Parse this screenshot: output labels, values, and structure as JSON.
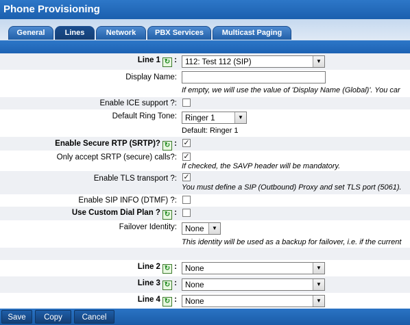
{
  "app": {
    "title": "Phone Provisioning"
  },
  "tabs": [
    {
      "label": "General"
    },
    {
      "label": "Lines"
    },
    {
      "label": "Network"
    },
    {
      "label": "PBX Services"
    },
    {
      "label": "Multicast Paging"
    }
  ],
  "form": {
    "line1": {
      "label": "Line 1",
      "colon": ":",
      "value": "112: Test 112 (SIP)"
    },
    "display_name": {
      "label": "Display Name:",
      "value": "",
      "hint": "If empty, we will use the value of 'Display Name (Global)'. You car"
    },
    "ice": {
      "label": "Enable ICE support ?:",
      "checked": false
    },
    "ring_tone": {
      "label": "Default Ring Tone:",
      "value": "Ringer 1",
      "default_text": "Default: Ringer 1"
    },
    "srtp": {
      "label": "Enable Secure RTP (SRTP)?",
      "colon": ":",
      "checked": true,
      "check_glyph": "✓"
    },
    "srtp_only": {
      "label": "Only accept SRTP (secure) calls?:",
      "checked": true,
      "check_glyph": "✓",
      "hint": "If checked, the SAVP header will be mandatory."
    },
    "tls": {
      "label": "Enable TLS transport ?:",
      "checked": true,
      "check_glyph": "✓",
      "hint": "You must define a SIP (Outbound) Proxy and set TLS port (5061)."
    },
    "sip_info": {
      "label": "Enable SIP INFO (DTMF) ?:",
      "checked": false
    },
    "dial_plan": {
      "label": "Use Custom Dial Plan ?",
      "colon": ":",
      "checked": false
    },
    "failover": {
      "label": "Failover Identity:",
      "value": "None",
      "hint": "This identity will be used as a backup for failover, i.e. if the current"
    },
    "line2": {
      "label": "Line 2",
      "colon": ":",
      "value": "None"
    },
    "line3": {
      "label": "Line 3",
      "colon": ":",
      "value": "None"
    },
    "line4": {
      "label": "Line 4",
      "colon": ":",
      "value": "None"
    }
  },
  "icons": {
    "refresh": "↻",
    "arrow": "▼"
  },
  "footer": {
    "save": "Save",
    "copy": "Copy",
    "cancel": "Cancel"
  },
  "colors": {
    "header": "#1b5fae",
    "tab_active": "#143e74",
    "shaded_row": "#eef0f4"
  }
}
